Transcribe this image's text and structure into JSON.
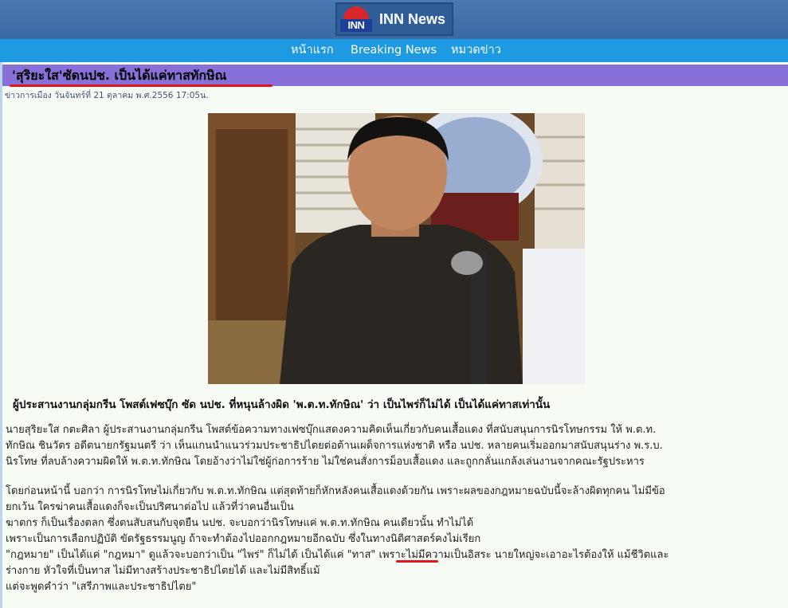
{
  "header": {
    "brand_title": "INN News",
    "logo_text": "INN"
  },
  "nav": {
    "items": [
      {
        "label": "หน้าแรก"
      },
      {
        "label": "Breaking News"
      },
      {
        "label": "หมวดข่าว"
      }
    ]
  },
  "article": {
    "headline": "'สุริยะใส'ซัดนปช. เป็นได้แค่ทาสทักษิณ",
    "meta": "ข่าวการเมือง วันจันทร์ที่ 21 ตุลาคม พ.ศ.2556 17:05น.",
    "caption": "ผู้ประสานงานกลุ่มกรีน โพสต์เฟซบุ๊ก ซัด นปช. ที่หนุนล้างผิด 'พ.ต.ท.ทักษิณ' ว่า เป็นไพร่ก็ไม่ได้ เป็นได้แค่ทาสเท่านั้น",
    "p1_lines": [
      "นายสุริยะใส กตะศิลา ผู้ประสานงานกลุ่มกรีน โพสต์ข้อความทางเฟซบุ๊กแสดงความคิดเห็นเกี่ยวกับคนเสื้อแดง ที่สนับสนุนการนิรโทษกรรม ให้ พ.ต.ท.",
      "ทักษิณ ชินวัตร อดีตนายกรัฐมนตรี ว่า เห็นแกนนำแนวร่วมประชาธิปไตยต่อต้านเผด็จการแห่งชาติ หรือ นปช. หลายคนเริ่มออกมาสนับสนุนร่าง พ.ร.บ.",
      "นิรโทษ ที่ลบล้างความผิดให้ พ.ต.ท.ทักษิณ โดยอ้างว่าไม่ใช่ผู้ก่อการร้าย ไม่ใช่คนสั่งการม็อบเสื้อแดง และถูกกลั่นแกล้งเล่นงานจากคณะรัฐประหาร"
    ],
    "p2_lines": [
      "โดยก่อนหน้านี้ บอกว่า การนิรโทษไม่เกี่ยวกับ พ.ต.ท.ทักษิณ แต่สุดท้ายก็หักหลังคนเสื้อแดงด้วยกัน เพราะผลของกฎหมายฉบับนี้จะล้างผิดทุกคน ไม่มีข้อ",
      "ยกเว้น ใครฆ่าคนเสื้อแดงก็จะเป็นปริศนาต่อไป แล้วที่ว่าคนอื่นเป็น",
      "ฆาตกร ก็เป็นเรื่องตลก ซึ่งตนสับสนกับจุดยืน นปช. จะบอกว่านิรโทษแค่ พ.ต.ท.ทักษิณ คนเดียวนั้น ทำไม่ได้",
      "เพราะเป็นการเลือกปฏิบัติ ขัดรัฐธรรมนูญ ถ้าจะทำต้องไปออกกฎหมายอีกฉบับ ซึ่งในทางนิติศาสตร์คงไม่เรียก",
      "\"กฎหมาย\" เป็นได้แค่ \"กฎหมา\" ดูแล้วจะบอกว่าเป็น \"ไพร่\" ก็ไม่ได้ เป็นได้แค่ \"ทาส\" เพราะไม่มีความเป็นอิสระ นายใหญ่จะเอาอะไรต้องให้ แม้ชีวิตและ",
      "ร่างกาย หัวใจที่เป็นทาส ไม่มีทางสร้างประชาธิปไตยได้ และไม่มีสิทธิ์แม้",
      "แต่จะพูดคำว่า \"เสรีภาพและประชาธิปไตย\""
    ]
  },
  "colors": {
    "topbar": "#3b69a5",
    "navbar": "#1e9ae3",
    "headline_bar": "#8870d8",
    "annotation": "#e0161c"
  }
}
